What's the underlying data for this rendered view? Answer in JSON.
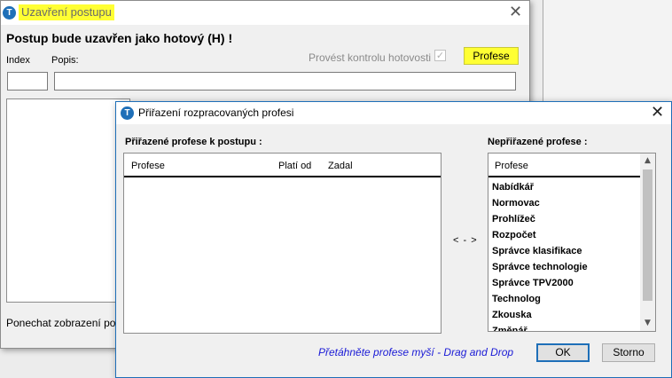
{
  "window_main": {
    "title": "Uzavření postupu",
    "heading": "Postup bude uzavřen jako hotový (H) !",
    "index_label": "Index",
    "popis_label": "Popis:",
    "check_label": "Provést kontrolu hotovosti",
    "check_mark": "✓",
    "profese_button": "Profese",
    "footer_text": "Ponechat zobrazení po so",
    "close": "✕"
  },
  "window_dialog": {
    "title": "Přiřazení rozpracovaných profesi",
    "close": "✕",
    "assigned_label": "Přiřazené profese k postupu :",
    "unassigned_label": "Nepřiřazené profese :",
    "assigned_columns": [
      "Profese",
      "Platí od",
      "Zadal"
    ],
    "unassigned_column": "Profese",
    "unassigned_items": [
      "Nabídkář",
      "Normovac",
      "Prohlížeč",
      "Rozpočet",
      "Správce klasifikace",
      "Správce technologie",
      "Správce TPV2000",
      "Technolog",
      "Zkouska",
      "Změnář"
    ],
    "move_arrows": "< - >",
    "hint": "Přetáhněte profese myší - Drag and Drop",
    "ok_button": "OK",
    "storno_button": "Storno"
  },
  "colors": {
    "highlight": "#ffff33",
    "accent": "#1e6fb8",
    "hint_text": "#1a1ad6"
  },
  "icons": {
    "app": "app-logo-icon",
    "close": "close-icon",
    "scroll_up": "chevron-up-icon",
    "scroll_down": "chevron-down-icon"
  }
}
